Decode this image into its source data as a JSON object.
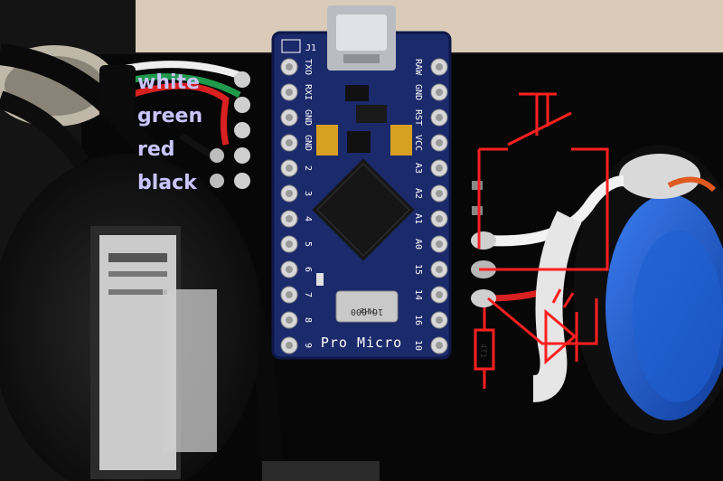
{
  "photo": {
    "subject": "Arduino Pro Micro board wired to an arcade button"
  },
  "board": {
    "name": "Pro Micro",
    "crystal_top": "16.000",
    "crystal_bottom": "MHz",
    "marker": "J1",
    "resistor_code": "4T1",
    "left_pins": [
      "TXO",
      "RXI",
      "GND",
      "GND",
      "2",
      "3",
      "4",
      "5",
      "6",
      "7",
      "8",
      "9"
    ],
    "right_pins": [
      "RAW",
      "GND",
      "RST",
      "VCC",
      "A3",
      "A2",
      "A1",
      "A0",
      "15",
      "14",
      "16",
      "10"
    ]
  },
  "wire_labels": {
    "white": "white",
    "green": "green",
    "red": "red",
    "black": "black"
  },
  "colors": {
    "board_blue": "#1b2a6b",
    "wire_label": "#c9c4ff",
    "schematic_red": "#ff2020",
    "button_blue": "#1e5fd0"
  }
}
